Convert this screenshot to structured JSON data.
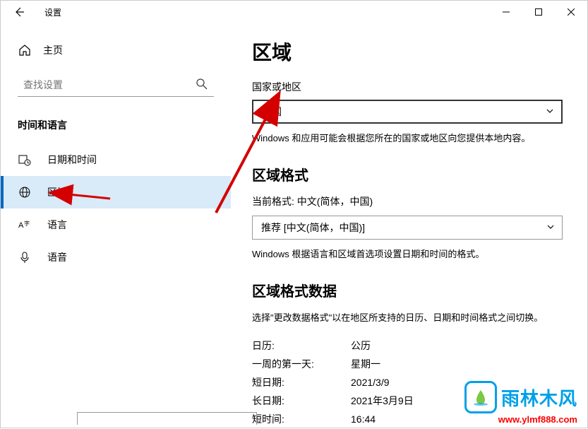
{
  "window": {
    "title": "设置",
    "minimize": "—",
    "maximize": "□",
    "close": "✕"
  },
  "sidebar": {
    "home": "主页",
    "search_placeholder": "查找设置",
    "section": "时间和语言",
    "items": [
      {
        "label": "日期和时间"
      },
      {
        "label": "区域"
      },
      {
        "label": "语言"
      },
      {
        "label": "语音"
      }
    ]
  },
  "main": {
    "title": "区域",
    "country_label": "国家或地区",
    "country_value": "中国",
    "country_hint": "Windows 和应用可能会根据您所在的国家或地区向您提供本地内容。",
    "format_title": "区域格式",
    "current_format": "当前格式: 中文(简体，中国)",
    "format_value": "推荐 [中文(简体，中国)]",
    "format_hint": "Windows 根据语言和区域首选项设置日期和时间的格式。",
    "data_title": "区域格式数据",
    "data_hint": "选择\"更改数据格式\"以在地区所支持的日历、日期和时间格式之间切换。",
    "rows": [
      {
        "k": "日历:",
        "v": "公历"
      },
      {
        "k": "一周的第一天:",
        "v": "星期一"
      },
      {
        "k": "短日期:",
        "v": "2021/3/9"
      },
      {
        "k": "长日期:",
        "v": "2021年3月9日"
      },
      {
        "k": "短时间:",
        "v": "16:44"
      }
    ]
  },
  "watermark": {
    "brand": "雨林木风",
    "url": "www.ylmf888.com"
  }
}
